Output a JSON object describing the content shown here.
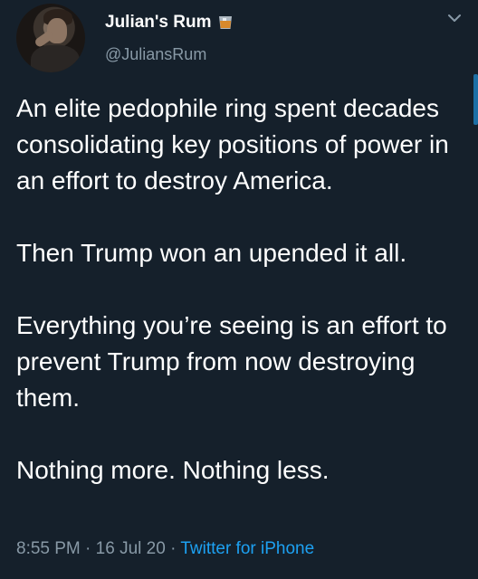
{
  "author": {
    "display_name": "Julian's Rum",
    "handle": "@JuliansRum",
    "badge_icon": "tumbler-glass-icon"
  },
  "tweet": {
    "paragraphs": [
      "An elite pedophile ring spent decades consolidating key positions of power in an effort to destroy America.",
      "Then Trump won an upended it all.",
      "Everything you’re seeing is an effort to prevent Trump from now destroying them.",
      "Nothing more. Nothing less."
    ],
    "time": "8:55 PM",
    "date": "16 Jul 20",
    "source": "Twitter for iPhone",
    "separator": "·"
  },
  "colors": {
    "background": "#15202b",
    "text": "#ffffff",
    "muted": "#8899a6",
    "link": "#1da1f2"
  }
}
